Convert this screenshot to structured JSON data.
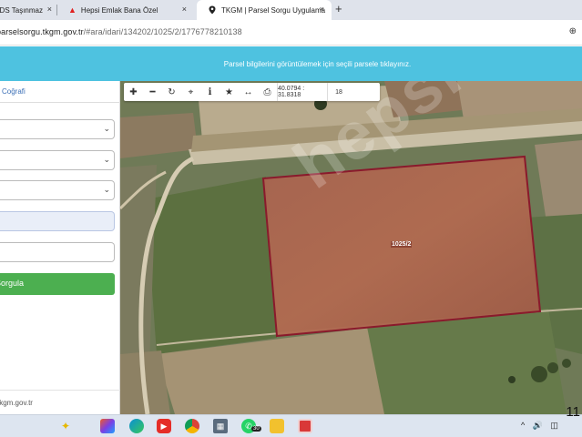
{
  "browser": {
    "tabs": [
      {
        "label": "EIDS Taşınmaz",
        "close": "×"
      },
      {
        "label": "Hepsi Emlak Bana Özel",
        "close": "×"
      },
      {
        "label": "TKGM | Parsel Sorgu Uygulama",
        "close": "×"
      }
    ],
    "new_tab": "+",
    "url_main": "parselsorgu.tkgm.gov.tr",
    "url_path": "/#ara/idari/134202/1025/2/1776778210138"
  },
  "banner": {
    "text": "Parsel bilgilerini görüntülemek için seçili parsele tıklayınız."
  },
  "sidebar": {
    "tab_label": "Coğrafi",
    "button_label": "Sorgula",
    "footer": "tkgm.gov.tr"
  },
  "map": {
    "coordinates": "40.0794 : 31.8318",
    "zoom": "18",
    "parcel_label": "1025/2",
    "watermark": "hepsiemlak",
    "tools": [
      "zoom-in-icon",
      "zoom-out-icon",
      "refresh-icon",
      "locate-icon",
      "info-icon",
      "star-icon",
      "measure-icon",
      "print-icon"
    ]
  },
  "taskbar": {
    "badge": "30",
    "time": "11"
  },
  "colors": {
    "banner": "#4ec2e0",
    "button": "#4caf50",
    "parcel_border": "#9b1b30"
  }
}
